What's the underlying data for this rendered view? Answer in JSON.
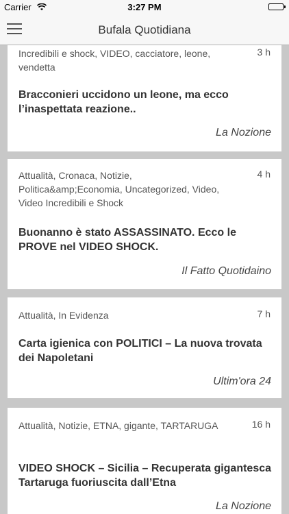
{
  "status_bar": {
    "carrier": "Carrier",
    "time": "3:27 PM"
  },
  "nav": {
    "title": "Bufala Quotidiana"
  },
  "articles": [
    {
      "categories": "Incredibili e shock, VIDEO, cacciatore, leone, vendetta",
      "time": "3 h",
      "headline": "Bracconieri uccidono un leone, ma ecco l’inaspettata reazione..",
      "source": "La Nozione"
    },
    {
      "categories": "Attualità, Cronaca, Notizie, Politica&amp;Economia, Uncategorized, Video, Video Incredibili e Shock",
      "time": "4 h",
      "headline": "Buonanno è stato ASSASSINATO. Ecco le PROVE nel VIDEO SHOCK.",
      "source": "Il Fatto Quotidaino"
    },
    {
      "categories": "Attualità, In Evidenza",
      "time": "7 h",
      "headline": "Carta igienica con POLITICI – La nuova trovata dei Napoletani",
      "source": "Ultim'ora 24"
    },
    {
      "categories": "Attualità, Notizie, ETNA, gigante, TARTARUGA",
      "time": "16 h",
      "headline": "VIDEO SHOCK – Sicilia – Recuperata gigantesca Tartaruga fuoriuscita dall’Etna",
      "source": "La Nozione"
    }
  ]
}
